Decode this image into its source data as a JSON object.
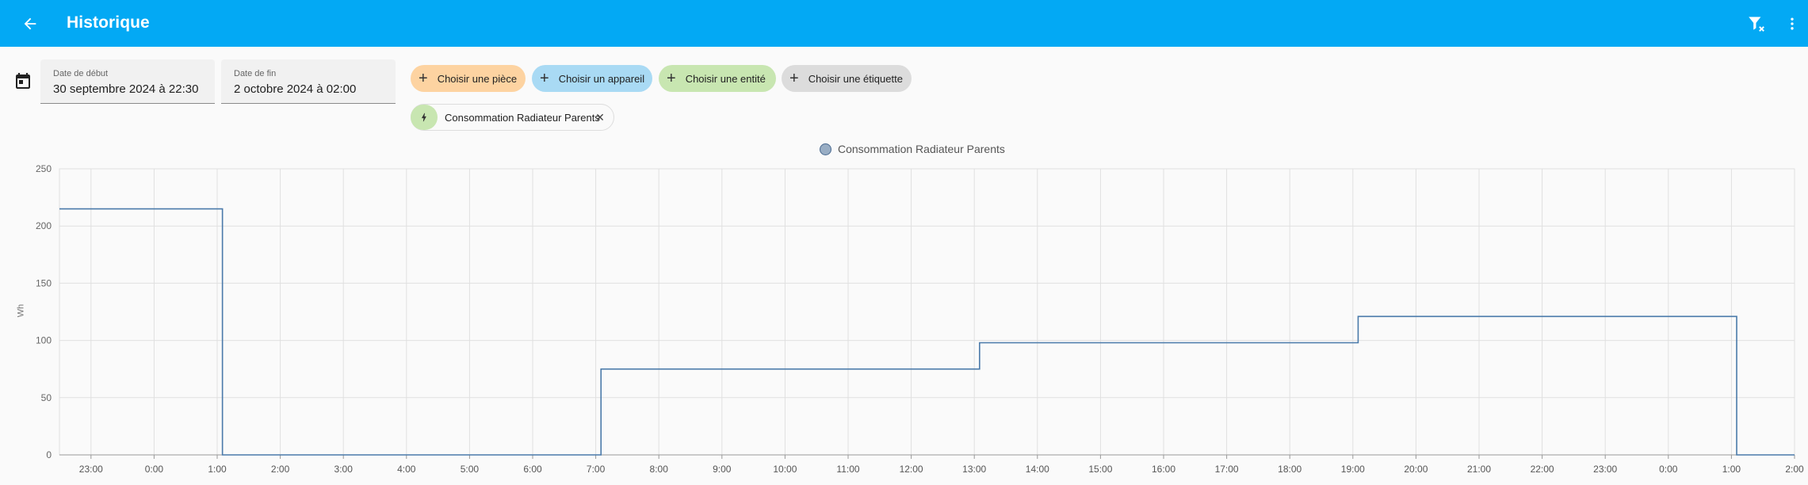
{
  "header": {
    "title": "Historique",
    "back_icon": "arrow-left-icon",
    "filter_icon": "filter-remove-icon",
    "menu_icon": "dots-vertical-icon",
    "color": "#03a9f4"
  },
  "date_range": {
    "start_label": "Date de début",
    "start_value": "30 septembre 2024 à 22:30",
    "end_label": "Date de fin",
    "end_value": "2 octobre 2024 à 02:00"
  },
  "pickers": {
    "area": "Choisir une pièce",
    "device": "Choisir un appareil",
    "entity": "Choisir une entité",
    "label": "Choisir une étiquette"
  },
  "selected_entity": {
    "name": "Consommation Radiateur Parents",
    "icon": "lightning-bolt-icon"
  },
  "chart_data": {
    "type": "line",
    "step": true,
    "legend": "Consommation Radiateur Parents",
    "ylabel": "Wh",
    "ylim": [
      0,
      250
    ],
    "yticks": [
      0,
      50,
      100,
      150,
      200,
      250
    ],
    "x_start": "2024-09-30 22:30",
    "x_end": "2024-10-02 02:00",
    "xticks": [
      "23:00",
      "0:00",
      "1:00",
      "2:00",
      "3:00",
      "4:00",
      "5:00",
      "6:00",
      "7:00",
      "8:00",
      "9:00",
      "10:00",
      "11:00",
      "12:00",
      "13:00",
      "14:00",
      "15:00",
      "16:00",
      "17:00",
      "18:00",
      "19:00",
      "20:00",
      "21:00",
      "22:00",
      "23:00",
      "0:00",
      "1:00",
      "2:00"
    ],
    "points": [
      {
        "x": "2024-09-30 22:30",
        "y": 215
      },
      {
        "x": "2024-10-01 01:05",
        "y": 0
      },
      {
        "x": "2024-10-01 07:05",
        "y": 75
      },
      {
        "x": "2024-10-01 13:05",
        "y": 98
      },
      {
        "x": "2024-10-01 19:05",
        "y": 121
      },
      {
        "x": "2024-10-02 01:05",
        "y": 0
      },
      {
        "x": "2024-10-02 02:00",
        "y": 0
      }
    ],
    "line_color": "#4a7aaa",
    "grid": true
  }
}
